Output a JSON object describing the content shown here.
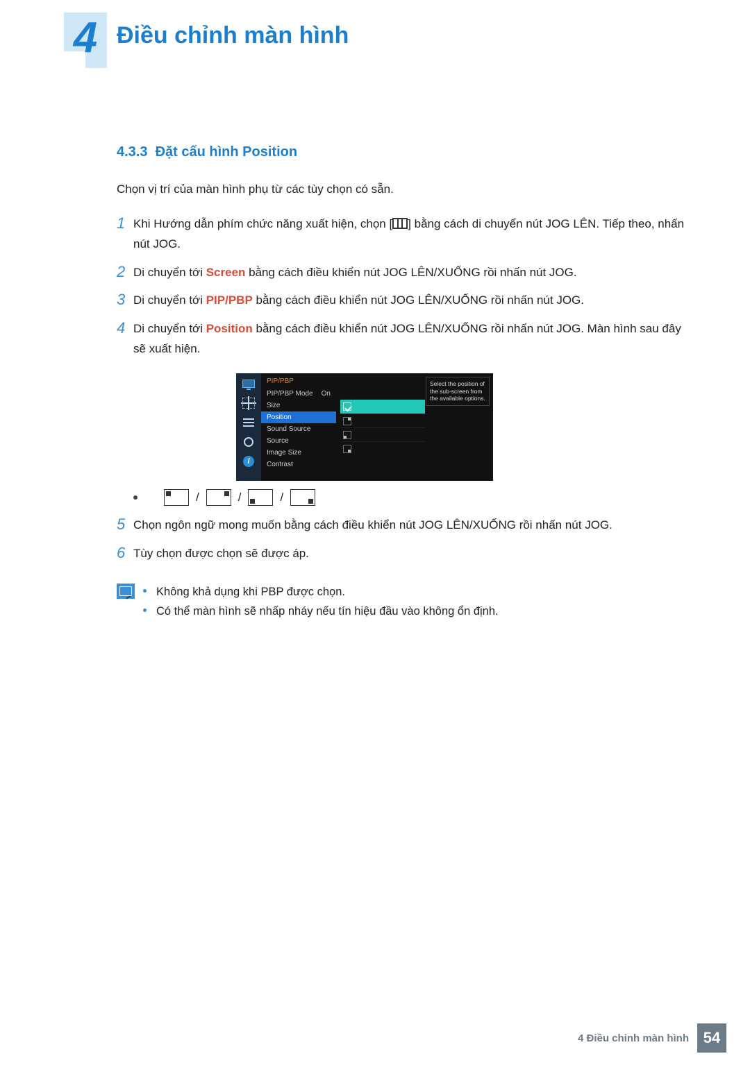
{
  "chapter": {
    "number": "4",
    "title": "Điều chỉnh màn hình"
  },
  "section": {
    "number": "4.3.3",
    "title": "Đặt cấu hình Position"
  },
  "intro": "Chọn vị trí của màn hình phụ từ các tùy chọn có sẵn.",
  "steps": {
    "s1": {
      "num": "1",
      "pre": "Khi Hướng dẫn phím chức năng xuất hiện, chọn [",
      "post": "] bằng cách di chuyển nút JOG LÊN. Tiếp theo, nhấn nút JOG."
    },
    "s2": {
      "num": "2",
      "pre": "Di chuyển tới ",
      "hl": "Screen",
      "post": " bằng cách điều khiển nút JOG LÊN/XUỐNG rồi nhấn nút JOG."
    },
    "s3": {
      "num": "3",
      "pre": "Di chuyển tới ",
      "hl": "PIP/PBP",
      "post": " bằng cách điều khiển nút JOG LÊN/XUỐNG rồi nhấn nút JOG."
    },
    "s4": {
      "num": "4",
      "pre": "Di chuyển tới ",
      "hl": "Position",
      "post": " bằng cách điều khiển nút JOG LÊN/XUỐNG rồi nhấn nút JOG. Màn hình sau đây sẽ xuất hiện."
    },
    "s5": {
      "num": "5",
      "text": "Chọn ngôn ngữ mong muốn bằng cách điều khiển nút JOG LÊN/XUỐNG rồi nhấn nút JOG."
    },
    "s6": {
      "num": "6",
      "text": "Tùy chọn được chọn sẽ được áp."
    }
  },
  "osd": {
    "menuTitle": "PIP/PBP",
    "items": {
      "mode": {
        "label": "PIP/PBP Mode",
        "value": "On"
      },
      "size": {
        "label": "Size"
      },
      "position": {
        "label": "Position"
      },
      "sound": {
        "label": "Sound Source"
      },
      "source": {
        "label": "Source"
      },
      "imagesize": {
        "label": "Image Size"
      },
      "contrast": {
        "label": "Contrast"
      }
    },
    "hint": "Select the position of the sub-screen from the available options.",
    "infoGlyph": "i"
  },
  "posSeparator": "/",
  "notes": {
    "n1": "Không khả dụng khi PBP được chọn.",
    "n2": "Có thể màn hình sẽ nhấp nháy nếu tín hiệu đầu vào không ổn định."
  },
  "footer": {
    "label": "4 Điều chỉnh màn hình",
    "page": "54"
  }
}
